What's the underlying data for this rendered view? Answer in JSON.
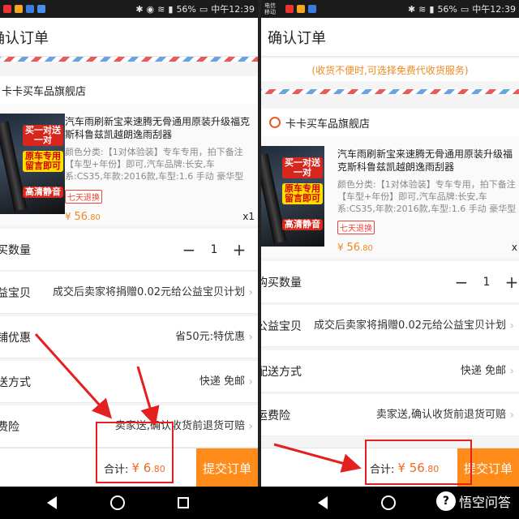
{
  "left": {
    "status": {
      "time": "中午12:39",
      "battery": "56%"
    },
    "title": "确认订单",
    "shop": "卡卡买车品旗舰店",
    "product": {
      "title": "汽车雨刷新宝来速腾无骨通用原装升级福克斯科鲁兹凯越朗逸雨刮器",
      "spec": "颜色分类:【1对体验装】专车专用，拍下备注【车型+年份】即可,汽车品牌:长安,车系:CS35,年款:2016款,车型:1.6 手动 豪华型",
      "tag": "七天退换",
      "price_symbol": "¥",
      "price_int": "56",
      "price_dec": ".80",
      "qty": "x1",
      "badges": [
        "买一对送一对",
        "原车专用留言即可",
        "高清静音"
      ]
    },
    "rows": {
      "buy_qty_label": "买数量",
      "qty_minus": "−",
      "qty_value": "1",
      "qty_plus": "+",
      "charity_label": "益宝贝",
      "charity_value": "成交后卖家将捐赠0.02元给公益宝贝计划",
      "discount_label": "铺优惠",
      "discount_value": "省50元:特优惠",
      "delivery_label": "送方式",
      "delivery_value": "快递 免邮",
      "insurance_label": "费险",
      "insurance_value": "卖家送,确认收货前退货可赔"
    },
    "bottom": {
      "total_label": "合计:",
      "total_symbol": "¥",
      "total_int": "6",
      "total_dec": ".80",
      "submit": "提交订单"
    }
  },
  "right": {
    "status": {
      "carrier": "电信 移动",
      "time": "中午12:39",
      "battery": "56%"
    },
    "title": "确认订单",
    "notice": "(收货不便时,可选择免费代收货服务)",
    "shop": "卡卡买车品旗舰店",
    "product": {
      "title": "汽车雨刷新宝来速腾无骨通用原装升级福克斯科鲁兹凯越朗逸雨刮器",
      "spec": "颜色分类:【1对体验装】专车专用，拍下备注【车型+年份】即可,汽车品牌:长安,车系:CS35,年款:2016款,车型:1.6 手动 豪华型",
      "tag": "七天退换",
      "price_symbol": "¥",
      "price_int": "56",
      "price_dec": ".80",
      "qty": "x",
      "badges": [
        "买一对送一对",
        "原车专用留言即可",
        "高清静音"
      ]
    },
    "rows": {
      "buy_qty_label": "购买数量",
      "qty_minus": "−",
      "qty_value": "1",
      "qty_plus": "+",
      "charity_label": "公益宝贝",
      "charity_value": "成交后卖家将捐赠0.02元给公益宝贝计划",
      "delivery_label": "配送方式",
      "delivery_value": "快递 免邮",
      "insurance_label": "运费险",
      "insurance_value": "卖家送,确认收货前退货可赔"
    },
    "bottom": {
      "total_label": "合计:",
      "total_symbol": "¥",
      "total_int": "56",
      "total_dec": ".80",
      "submit": "提交订单"
    }
  },
  "watermark": "悟空问答",
  "colors": {
    "accent": "#ff8c1a",
    "price": "#ef8a21",
    "annotation": "#e41f1f"
  }
}
